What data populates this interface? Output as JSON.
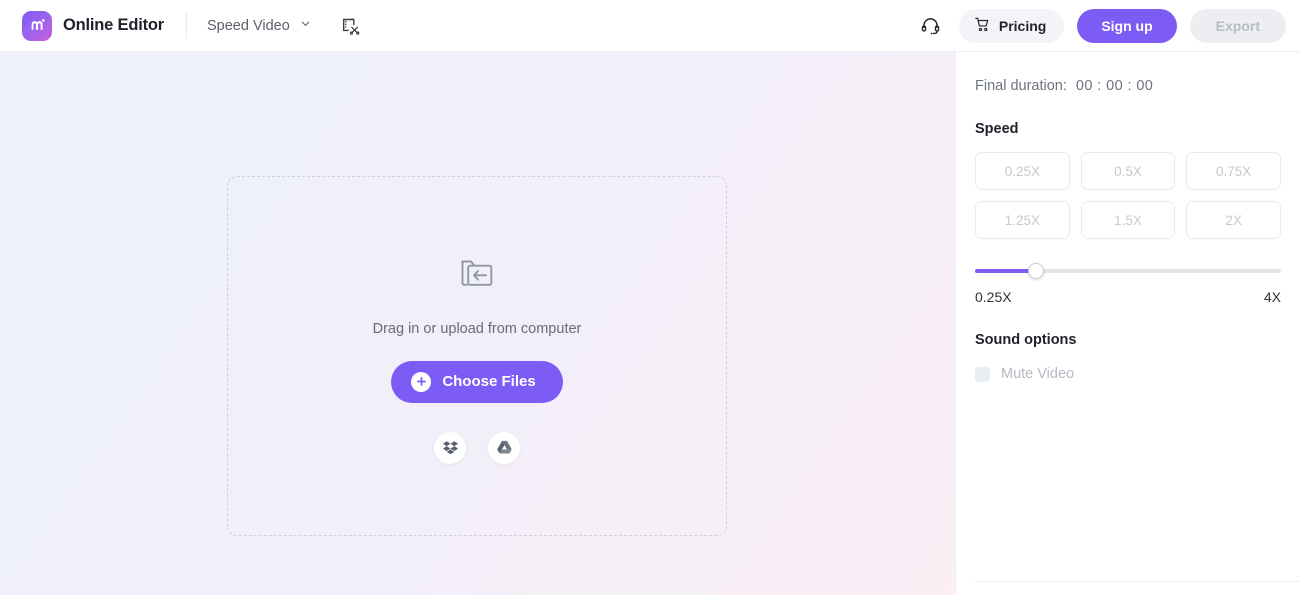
{
  "topbar": {
    "logo_icon": "app-logo-m-icon",
    "brand_name": "Online Editor",
    "project_name": "Speed Video",
    "project_chevron_icon": "chevron-down-icon",
    "video_cut_icon": "video-cut-icon",
    "support_icon": "headset-support-icon",
    "pricing": {
      "icon": "shopping-cart-icon",
      "label": "Pricing"
    },
    "signup_label": "Sign up",
    "export_label": "Export",
    "accent_color": "#7c5cf5",
    "export_disabled_bg": "#eceef2",
    "export_disabled_text": "#b9bcc4"
  },
  "canvas": {
    "dropzone": {
      "icon": "folder-import-icon",
      "hint_text": "Drag in or upload from computer",
      "choose_files_label": "Choose Files",
      "choose_files_icon": "plus-circle-icon",
      "cloud_sources": [
        {
          "name": "dropbox-icon",
          "label": "Dropbox"
        },
        {
          "name": "google-drive-icon",
          "label": "Google Drive"
        }
      ]
    },
    "background_start": "#eef1f9",
    "background_end": "#fbeef5"
  },
  "panel": {
    "final_duration": {
      "label": "Final duration:",
      "value": "00 : 00 : 00"
    },
    "speed": {
      "title": "Speed",
      "presets": [
        {
          "label": "0.25X"
        },
        {
          "label": "0.5X"
        },
        {
          "label": "0.75X"
        },
        {
          "label": "1.25X"
        },
        {
          "label": "1.5X"
        },
        {
          "label": "2X"
        }
      ],
      "slider": {
        "min_label": "0.25X",
        "max_label": "4X",
        "fill_percent": 20,
        "handle_percent": 20,
        "fill_color": "#7c5cf5",
        "track_color": "#e4e5e9"
      }
    },
    "sound": {
      "title": "Sound options",
      "mute_label": "Mute Video",
      "mute_checked": false
    }
  }
}
